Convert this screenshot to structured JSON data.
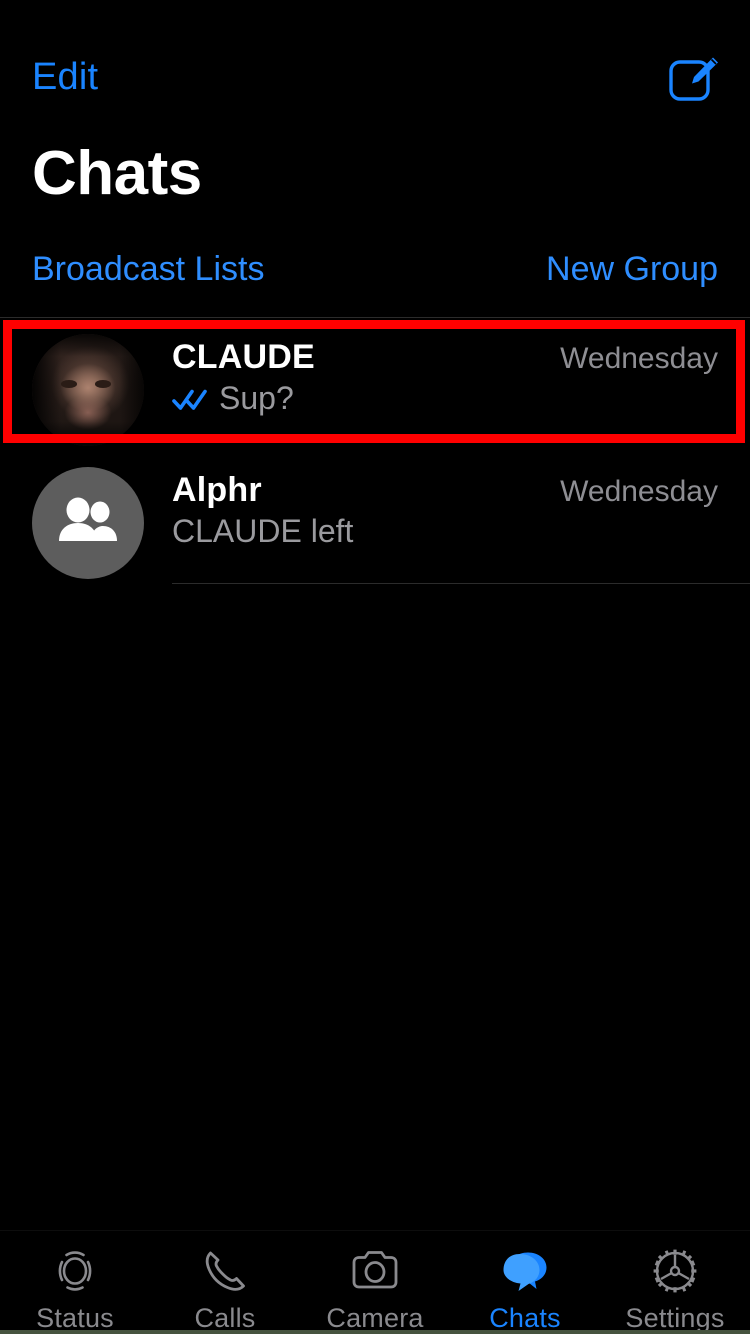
{
  "app": {
    "accent_blue": "#1a84ff",
    "highlight_red": "#ff0000",
    "background": "#000000"
  },
  "navbar": {
    "edit_label": "Edit",
    "compose_icon": "compose-icon"
  },
  "header": {
    "title": "Chats"
  },
  "subactions": {
    "broadcast_label": "Broadcast Lists",
    "new_group_label": "New Group"
  },
  "chats": [
    {
      "name": "CLAUDE",
      "time": "Wednesday",
      "preview": "Sup?",
      "status_icon": "double-check-icon",
      "avatar_type": "photo",
      "highlighted": true
    },
    {
      "name": "Alphr",
      "time": "Wednesday",
      "preview": "CLAUDE left",
      "status_icon": "",
      "avatar_type": "group",
      "highlighted": false
    }
  ],
  "tabbar": {
    "items": [
      {
        "label": "Status",
        "icon": "status-rings-icon",
        "active": false
      },
      {
        "label": "Calls",
        "icon": "phone-icon",
        "active": false
      },
      {
        "label": "Camera",
        "icon": "camera-icon",
        "active": false
      },
      {
        "label": "Chats",
        "icon": "chat-bubbles-icon",
        "active": true
      },
      {
        "label": "Settings",
        "icon": "gear-icon",
        "active": false
      }
    ]
  }
}
